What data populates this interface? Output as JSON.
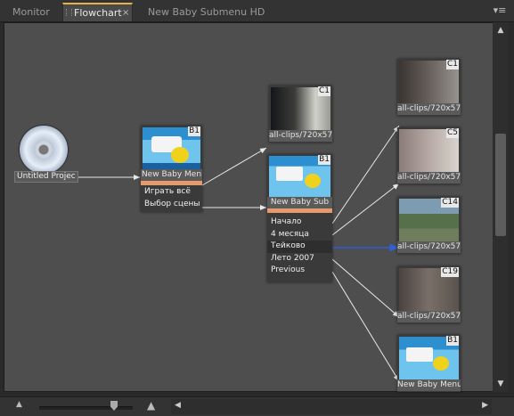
{
  "tabs": [
    {
      "label": "Monitor",
      "active": false
    },
    {
      "label": "Flowchart",
      "active": true
    },
    {
      "label": "New Baby Submenu HD",
      "active": false
    }
  ],
  "disc": {
    "label": "Untitled Projec"
  },
  "main_menu": {
    "title": "New Baby Men",
    "badge": "B1",
    "items": [
      "Играть всё",
      "Выбор сцены"
    ]
  },
  "submenu": {
    "title": "New Baby Sub",
    "badge": "B1",
    "items": [
      "Начало",
      "4 месяца",
      "Тейково",
      "Лето 2007",
      "Previous"
    ]
  },
  "clip_top": {
    "label": "all-clips/720x57",
    "badge": "C1"
  },
  "right_nodes": [
    {
      "label": "all-clips/720x57",
      "badge": "C1"
    },
    {
      "label": "all-clips/720x57",
      "badge": "C5"
    },
    {
      "label": "all-clips/720x57",
      "badge": "C14"
    },
    {
      "label": "all-clips/720x57",
      "badge": "C19"
    },
    {
      "label": "New Baby Menu",
      "badge": "B1"
    }
  ],
  "colors": {
    "accent": "#e8b04a",
    "link_highlight": "#2f5fd4",
    "line": "#e8e8e8"
  }
}
